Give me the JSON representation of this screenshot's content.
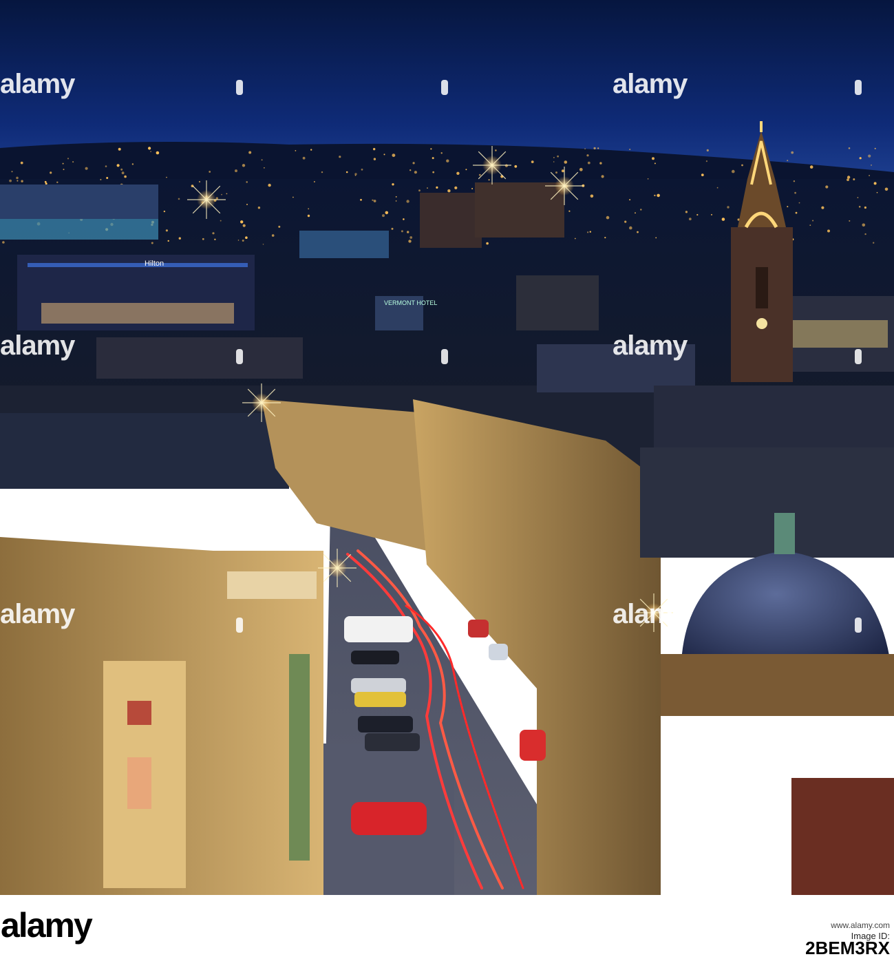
{
  "watermark": {
    "text": "alamy"
  },
  "signs": {
    "hotel": "Hilton",
    "vermont": "VERMONT HOTEL"
  },
  "footer": {
    "logo": "alamy",
    "image_id_label": "Image ID:",
    "image_id": "2BEM3RX",
    "site": "www.alamy.com"
  },
  "colors": {
    "sky_top": "#071a4a",
    "sky_horizon": "#1c3a8c",
    "stone_lit": "#d9b77a",
    "light_trail": "#ff3a3a",
    "sodium_light": "#ffc25a"
  }
}
